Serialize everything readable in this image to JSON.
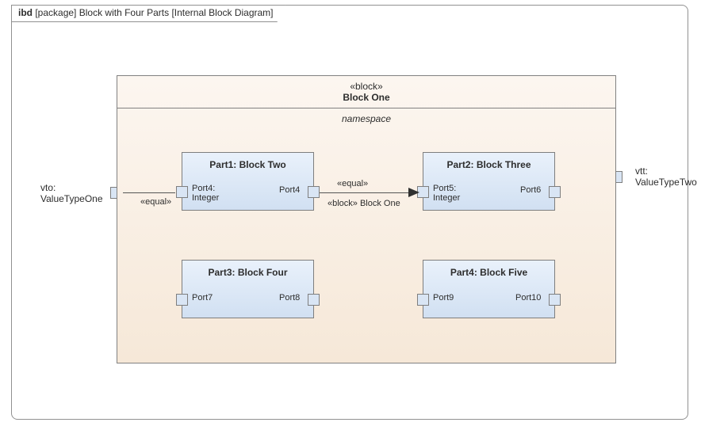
{
  "frame": {
    "kind": "ibd",
    "pkg": "[package]",
    "name": "Block with Four Parts",
    "type": "[Internal Block Diagram]"
  },
  "blockOne": {
    "stereo": "«block»",
    "title": "Block One",
    "namespace": "namespace"
  },
  "ext": {
    "left_name": "vto:",
    "left_type": "ValueTypeOne",
    "right_name": "vtt:",
    "right_type": "ValueTypeTwo"
  },
  "parts": {
    "p1": {
      "title": "Part1: Block Two",
      "pl": "Port4:",
      "plType": "Integer",
      "pr": "Port4"
    },
    "p2": {
      "title": "Part2: Block Three",
      "pl": "Port5:",
      "plType": "Integer",
      "pr": "Port6"
    },
    "p3": {
      "title": "Part3: Block Four",
      "pl": "Port7",
      "pr": "Port8"
    },
    "p4": {
      "title": "Part4: Block Five",
      "pl": "Port9",
      "pr": "Port10"
    }
  },
  "conn": {
    "c1_label": "«equal»",
    "c2_label": "«equal»",
    "c2_sublabel": "«block» Block One"
  }
}
